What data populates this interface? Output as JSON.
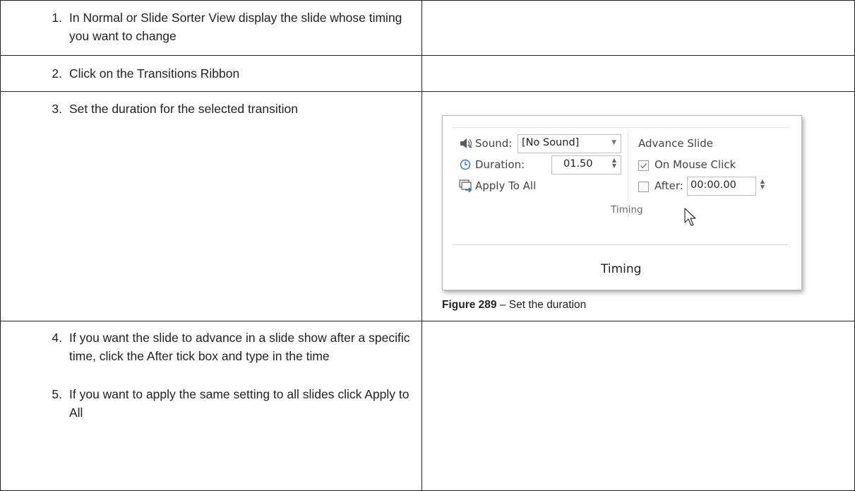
{
  "steps": [
    {
      "num": "1.",
      "text": "In Normal or Slide Sorter View display the slide whose timing you want to change"
    },
    {
      "num": "2.",
      "text": "Click on the Transitions Ribbon"
    },
    {
      "num": "3.",
      "text": "Set the duration for the selected transition"
    },
    {
      "num": "4.",
      "text": "If you want the slide to advance in a slide show after a specific time, click the After tick box and type in the time"
    },
    {
      "num": "5.",
      "text": "If you want to apply the same setting to all slides click Apply to All"
    }
  ],
  "ribbon": {
    "sound_label": "Sound:",
    "sound_value": "[No Sound]",
    "duration_label": "Duration:",
    "duration_value": "01.50",
    "apply_all_label": "Apply To All",
    "advance_heading": "Advance Slide",
    "on_mouse_click_label": "On Mouse Click",
    "on_mouse_click_checked": true,
    "after_label": "After:",
    "after_checked": false,
    "after_value": "00:00.00",
    "group_label": "Timing",
    "callout_label": "Timing"
  },
  "figure": {
    "number": "Figure 289",
    "caption": " – Set the duration"
  }
}
